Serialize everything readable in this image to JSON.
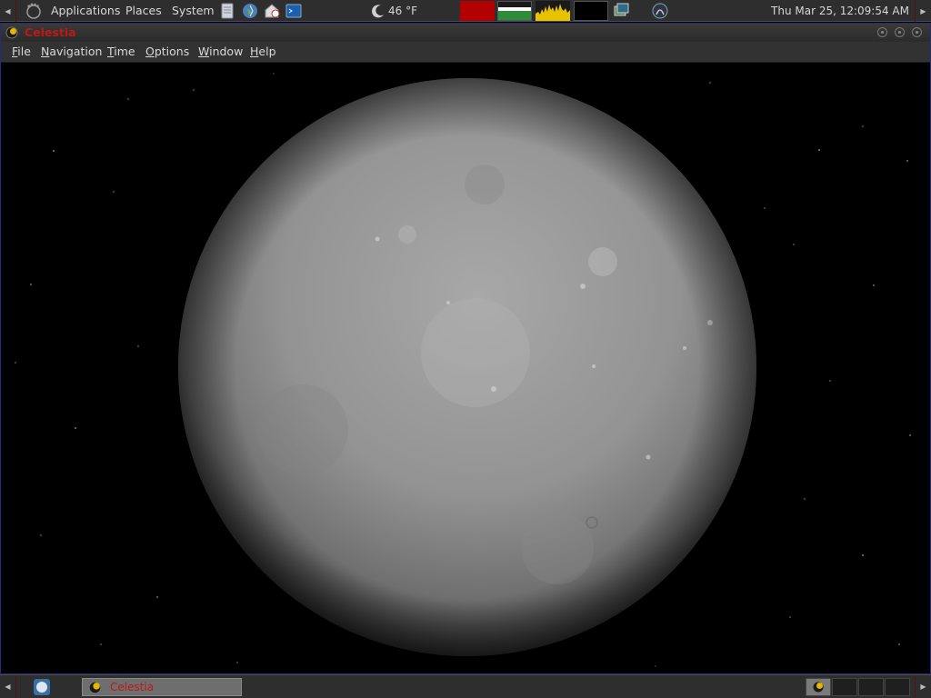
{
  "top_panel": {
    "menus": [
      "Applications",
      "Places",
      "System"
    ],
    "weather": {
      "icon": "moon-icon",
      "temperature": "46 °F"
    },
    "clock": "Thu Mar 25, 12:09:54 AM",
    "launchers": [
      "notes-icon",
      "web-browser-icon",
      "mail-clock-icon",
      "terminal-icon"
    ],
    "colors": {
      "cpu_monitor": "#b30000",
      "net_monitor": "#2e8b3a",
      "mem_monitor": "#e6c200"
    }
  },
  "window": {
    "title": "Celestia",
    "menu": [
      {
        "label": "File",
        "key": "F",
        "rest": "ile"
      },
      {
        "label": "Navigation",
        "key": "N",
        "rest": "avigation"
      },
      {
        "label": "Time",
        "key": "T",
        "rest": "ime"
      },
      {
        "label": "Options",
        "key": "O",
        "rest": "ptions"
      },
      {
        "label": "Window",
        "key": "W",
        "rest": "indow"
      },
      {
        "label": "Help",
        "key": "H",
        "rest": "elp"
      }
    ],
    "title_color": "#c01818"
  },
  "bottom_panel": {
    "tasks": [
      {
        "label": "Celestia",
        "icon": "celestia-icon"
      }
    ]
  }
}
